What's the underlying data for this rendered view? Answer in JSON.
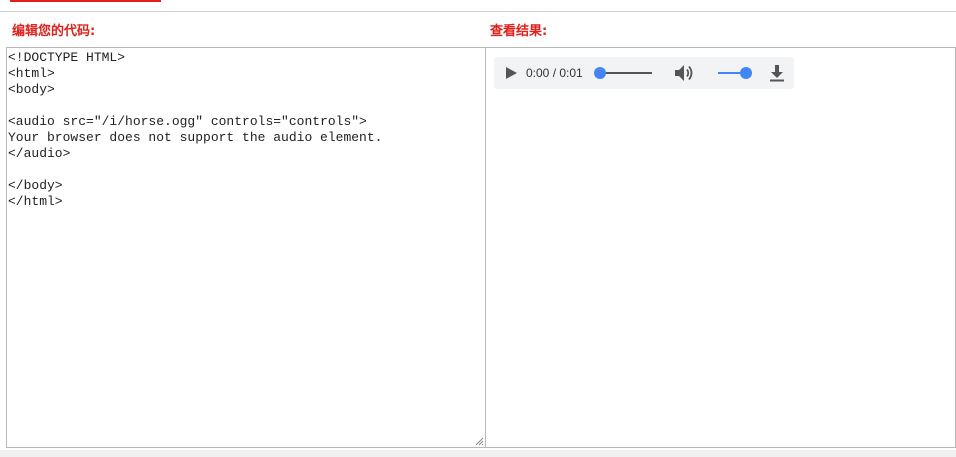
{
  "labels": {
    "edit_code": "编辑您的代码:",
    "view_result": "查看结果:"
  },
  "editor": {
    "code": "<!DOCTYPE HTML>\n<html>\n<body>\n\n<audio src=\"/i/horse.ogg\" controls=\"controls\">\nYour browser does not support the audio element.\n</audio>\n\n</body>\n</html>"
  },
  "player": {
    "time": "0:00 / 0:01",
    "progress_fraction": 0.0,
    "volume_fraction": 1.0,
    "icons": {
      "play": "play-icon",
      "volume": "volume-icon",
      "download": "download-icon"
    }
  },
  "colors": {
    "accent": "#e0211b",
    "player_blue": "#4285f4",
    "player_bg": "#f1f3f4"
  }
}
